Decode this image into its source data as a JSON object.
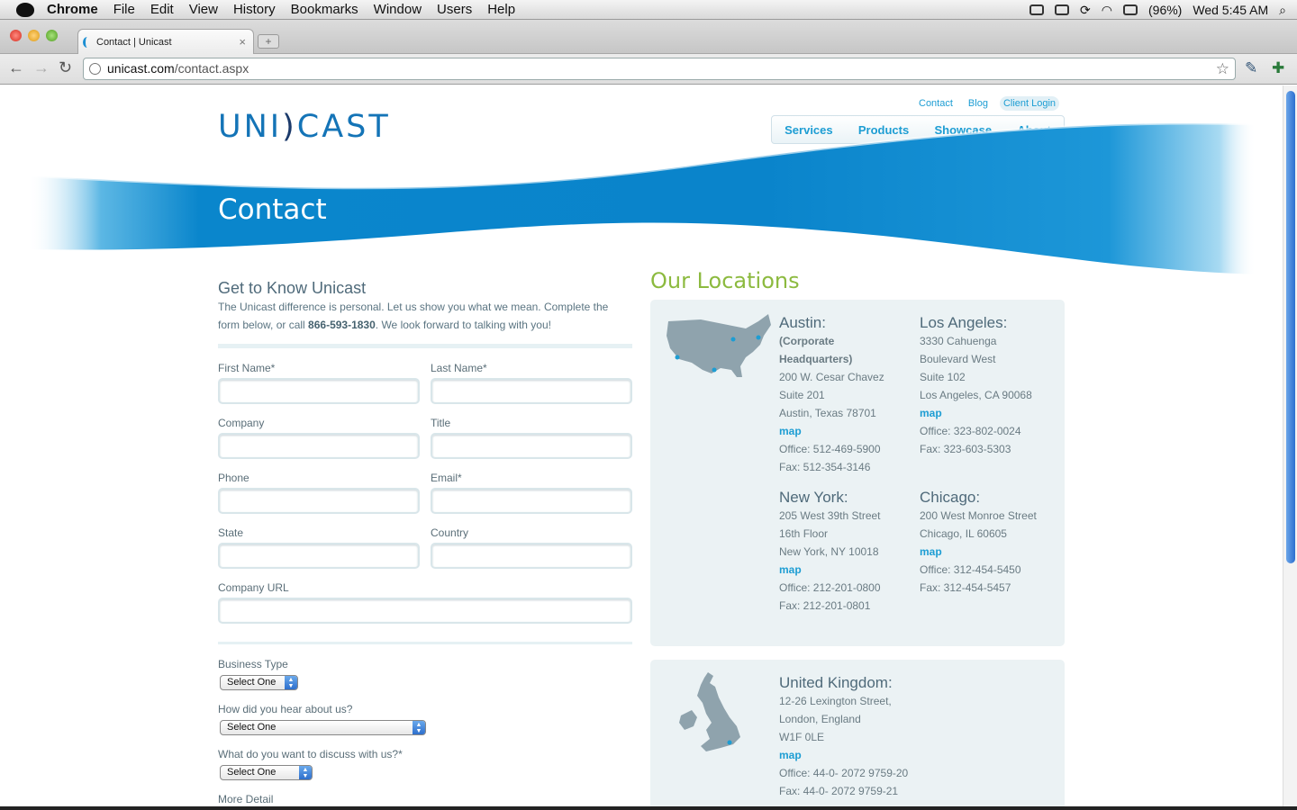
{
  "menubar": {
    "app": "Chrome",
    "menus": [
      "File",
      "Edit",
      "View",
      "History",
      "Bookmarks",
      "Window",
      "Users",
      "Help"
    ],
    "battery": "(96%)",
    "clock": "Wed 5:45 AM"
  },
  "browser": {
    "tab_title": "Contact | Unicast",
    "url_host": "unicast.com",
    "url_path": "/contact.aspx"
  },
  "header": {
    "logo_left": "UNI",
    "logo_mark": ")",
    "logo_right": "CAST",
    "top_links": [
      "Contact",
      "Blog",
      "Client Login"
    ],
    "nav": [
      "Services",
      "Products",
      "Showcase",
      "About"
    ]
  },
  "banner": {
    "title": "Contact"
  },
  "form": {
    "title": "Get to Know Unicast",
    "intro_before": "The Unicast difference is personal. Let us show you what we mean. Complete the form below, or call ",
    "intro_phone": "866-593-1830",
    "intro_after": ". We look forward to talking with you!",
    "fields": {
      "first_name": "First Name*",
      "last_name": "Last Name*",
      "company": "Company",
      "title": "Title",
      "phone": "Phone",
      "email": "Email*",
      "state": "State",
      "country": "Country",
      "company_url": "Company URL"
    },
    "business_type_label": "Business Type",
    "hear_label": "How did you hear about us?",
    "discuss_label": "What do you want to discuss with us?*",
    "select_default": "Select One",
    "more_detail": "More Detail"
  },
  "locations": {
    "title": "Our Locations",
    "map_link": "map",
    "austin": {
      "name": "Austin:",
      "sub": "(Corporate Headquarters)",
      "lines": [
        "200 W. Cesar Chavez",
        "Suite 201",
        "Austin, Texas 78701"
      ],
      "office": "Office: 512-469-5900",
      "fax": "Fax: 512-354-3146"
    },
    "la": {
      "name": "Los Angeles:",
      "lines": [
        "3330 Cahuenga",
        "Boulevard West",
        "Suite 102",
        "Los Angeles, CA 90068"
      ],
      "office": "Office: 323-802-0024",
      "fax": "Fax: 323-603-5303"
    },
    "ny": {
      "name": "New York:",
      "lines": [
        "205 West 39th Street",
        "16th Floor",
        "New York, NY 10018"
      ],
      "office": "Office: 212-201-0800",
      "fax": "Fax: 212-201-0801"
    },
    "chicago": {
      "name": "Chicago:",
      "lines": [
        "200 West Monroe Street",
        "Chicago, IL 60605"
      ],
      "office": "Office: 312-454-5450",
      "fax": "Fax: 312-454-5457"
    },
    "uk": {
      "name": "United Kingdom:",
      "lines": [
        "12-26 Lexington Street,",
        "London, England",
        "W1F 0LE"
      ],
      "office": "Office: 44-0- 2072 9759-20",
      "fax": "Fax: 44-0- 2072 9759-21"
    }
  },
  "colors": {
    "brand_blue": "#1474b7",
    "link_blue": "#1d9dd3",
    "locations_green": "#8cba3f",
    "panel_bg": "#ebf2f4"
  }
}
